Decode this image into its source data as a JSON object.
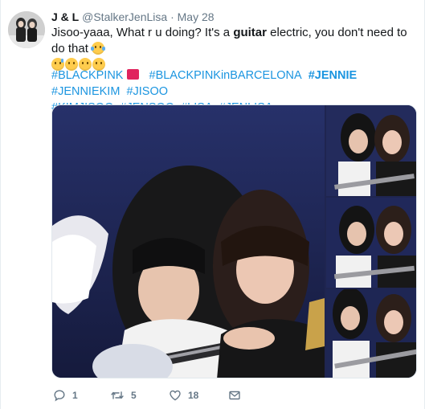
{
  "tweet": {
    "author_name": "J & L",
    "handle": "@StalkerJenLisa",
    "separator": "·",
    "date": "May 28",
    "text_before": "Jisoo-yaaa, What r u doing? It's a ",
    "text_bold": "guitar",
    "text_after": " electric, you don't need to do that",
    "emojis": [
      "face-with-tears-of-joy",
      "grinning-sweat",
      "squinting-laugh",
      "slight-smile",
      "no-mouth"
    ],
    "hashtags": [
      {
        "text": "#BLACKPINK",
        "bold": false,
        "badge": true
      },
      {
        "text": "#BLACKPINKinBARCELONA",
        "bold": false
      },
      {
        "text": "#JENNIE",
        "bold": true
      },
      {
        "text": "#JENNIEKIM",
        "bold": false
      },
      {
        "text": "#JISOO",
        "bold": false
      },
      {
        "text": "#KIMJISOO",
        "bold": false
      },
      {
        "text": "#JENSOO",
        "bold": false
      },
      {
        "text": "#LISA",
        "bold": false
      },
      {
        "text": "#JENLISA",
        "bold": false
      }
    ],
    "media": {
      "photos": [
        "main-photo",
        "thumbnail-1",
        "thumbnail-2",
        "thumbnail-3"
      ]
    },
    "actions": {
      "reply_count": "1",
      "retweet_count": "5",
      "like_count": "18",
      "message_count": ""
    }
  },
  "colors": {
    "link": "#1b95e0",
    "secondary_text": "#657786",
    "primary_text": "#14171a",
    "stage_blue": "#1f2550"
  }
}
